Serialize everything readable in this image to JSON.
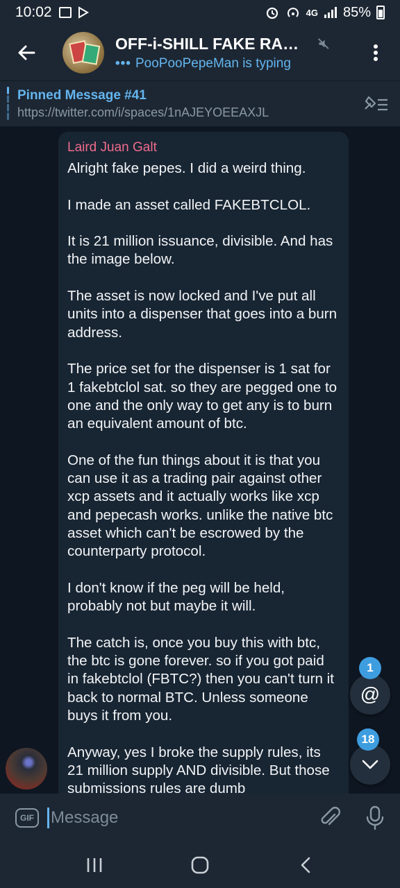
{
  "status_bar": {
    "time": "10:02",
    "network": "4G",
    "battery": "85%"
  },
  "header": {
    "title": "OFF-i-SHILL FAKE RARE P...",
    "subtitle_dots": "•••",
    "subtitle": "PooPooPepeMan is typing"
  },
  "pinned": {
    "title": "Pinned Message #41",
    "text": "https://twitter.com/i/spaces/1nAJEYOEEAXJL"
  },
  "message": {
    "sender": "Laird Juan Galt",
    "sender_color": "#ef6c8c",
    "paragraphs": [
      "Alright fake pepes. I did a weird thing.",
      "I made an asset called FAKEBTCLOL.",
      "It is 21 million issuance, divisible. And has the image below.",
      "The asset is now locked and I've put all units into a dispenser that goes into a burn address.",
      "The price set for the dispenser is 1 sat for 1 fakebtclol sat. so they are pegged one to one and the only way to get any is to burn an equivalent amount of btc.",
      "One of the fun things about it is that you can use it as a trading pair against other xcp assets and it actually works like xcp and pepecash works.  unlike the native btc asset which can't be escrowed by the counterparty protocol.",
      "I don't know if the peg will be held, probably not but maybe it will.",
      "The catch is, once you buy this with btc, the btc is gone forever. so if you got paid in fakebtclol (FBTC?) then you can't turn it back to normal BTC. Unless someone buys it from you.",
      "Anyway, yes I broke the supply rules, its 21 million supply AND divisible. But those submissions rules are dumb"
    ]
  },
  "fabs": {
    "mention_icon": "@",
    "mention_count": "1",
    "scroll_down_count": "18"
  },
  "input": {
    "gif_label": "GIF",
    "placeholder": "Message"
  },
  "colors": {
    "accent": "#64b5ef",
    "badge": "#3e9ddf",
    "bubble": "#182533",
    "background": "#0e1621"
  }
}
